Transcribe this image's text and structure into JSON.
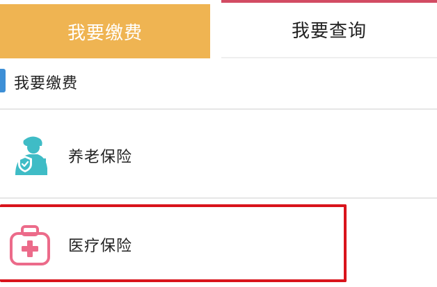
{
  "tabs": {
    "pay_label": "我要缴费",
    "query_label": "我要查询"
  },
  "section": {
    "title": "我要缴费"
  },
  "items": [
    {
      "label": "养老保险",
      "icon": "elderly-person-icon"
    },
    {
      "label": "医疗保险",
      "icon": "medical-kit-icon"
    }
  ],
  "colors": {
    "active_tab": "#efb452",
    "tab_accent_line": "#d24b63",
    "section_marker": "#3d8fd6",
    "pension_icon": "#3fbcc6",
    "medical_icon": "#ec6b8a",
    "highlight_box": "#d9141c"
  }
}
